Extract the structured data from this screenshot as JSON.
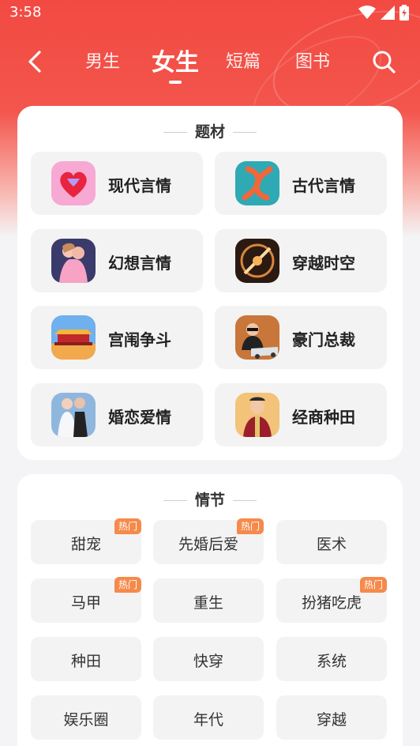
{
  "status": {
    "time": "3:58"
  },
  "nav": {
    "tabs": [
      {
        "label": "男生",
        "active": false
      },
      {
        "label": "女生",
        "active": true
      },
      {
        "label": "短篇",
        "active": false
      },
      {
        "label": "图书",
        "active": false
      }
    ]
  },
  "theme": {
    "title": "题材",
    "items": [
      {
        "label": "现代言情",
        "icon": "heart-gem-icon"
      },
      {
        "label": "古代言情",
        "icon": "koi-fish-icon"
      },
      {
        "label": "幻想言情",
        "icon": "fantasy-couple-icon"
      },
      {
        "label": "穿越时空",
        "icon": "time-portal-icon"
      },
      {
        "label": "宫闱争斗",
        "icon": "palace-icon"
      },
      {
        "label": "豪门总裁",
        "icon": "ceo-car-icon"
      },
      {
        "label": "婚恋爱情",
        "icon": "wedding-couple-icon"
      },
      {
        "label": "经商种田",
        "icon": "merchant-icon"
      }
    ]
  },
  "plot": {
    "title": "情节",
    "hot_label": "热门",
    "tags": [
      {
        "label": "甜宠",
        "hot": true
      },
      {
        "label": "先婚后爱",
        "hot": true
      },
      {
        "label": "医术",
        "hot": false
      },
      {
        "label": "马甲",
        "hot": true
      },
      {
        "label": "重生",
        "hot": false
      },
      {
        "label": "扮猪吃虎",
        "hot": true
      },
      {
        "label": "种田",
        "hot": false
      },
      {
        "label": "快穿",
        "hot": false
      },
      {
        "label": "系统",
        "hot": false
      },
      {
        "label": "娱乐圈",
        "hot": false
      },
      {
        "label": "年代",
        "hot": false
      },
      {
        "label": "穿越",
        "hot": false
      }
    ]
  },
  "colors": {
    "brand": "#f24a42",
    "hot_badge": "#f58a4b"
  }
}
